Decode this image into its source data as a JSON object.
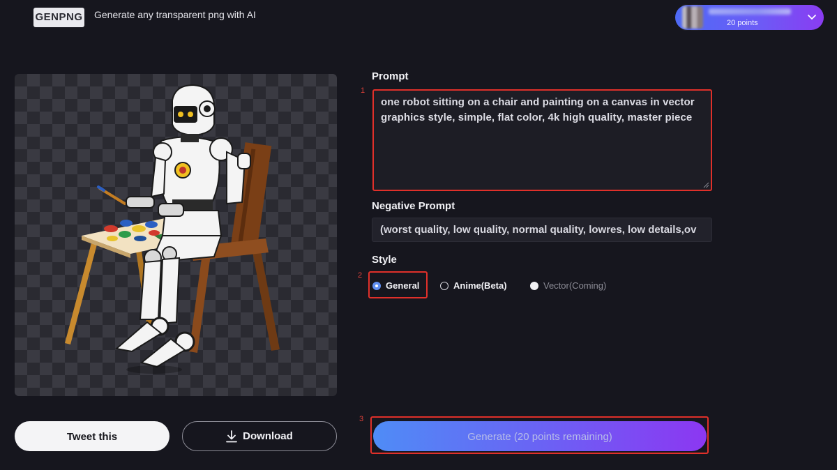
{
  "header": {
    "logo_text": "GENPNG",
    "tagline": "Generate any transparent png with AI",
    "user_points": "20 points"
  },
  "preview": {
    "image_subject": "robot-painting-on-canvas",
    "tweet_label": "Tweet this",
    "download_label": "Download"
  },
  "form": {
    "prompt_label": "Prompt",
    "prompt_value": "one robot sitting on a chair and painting on a canvas in vector graphics style, simple, flat color, 4k high quality, master piece",
    "negative_label": "Negative Prompt",
    "negative_value": "(worst quality, low quality, normal quality, lowres, low details,ov",
    "style_label": "Style",
    "styles": [
      {
        "label": "General",
        "selected": true
      },
      {
        "label": "Anime(Beta)",
        "selected": false
      },
      {
        "label": "Vector(Coming)",
        "selected": false,
        "disabled": true
      }
    ],
    "generate_label": "Generate (20 points remaining)"
  },
  "markers": [
    "1",
    "2",
    "3"
  ],
  "colors": {
    "background": "#16161e",
    "annotation_red": "#e0302a",
    "accent_gradient_start": "#4f8cf6",
    "accent_gradient_end": "#8c37f2"
  }
}
